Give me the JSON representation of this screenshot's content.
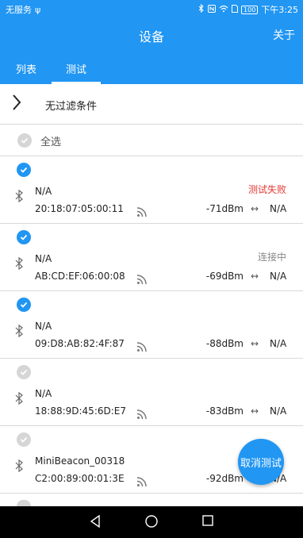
{
  "statusbar": {
    "carrier": "无服务",
    "usb_symbol": "ψ",
    "battery": "100",
    "time": "下午3:25"
  },
  "appbar": {
    "title": "设备",
    "about": "关于"
  },
  "tabs": [
    {
      "label": "列表"
    },
    {
      "label": "测试"
    }
  ],
  "filter": {
    "label": "无过滤条件"
  },
  "select_all": {
    "label": "全选"
  },
  "devices": [
    {
      "name": "N/A",
      "mac": "20:18:07:05:00:11",
      "rssi": "-71dBm",
      "arrows": "↔",
      "distance": "N/A",
      "status": "测试失败",
      "checked": true
    },
    {
      "name": "N/A",
      "mac": "AB:CD:EF:06:00:08",
      "rssi": "-69dBm",
      "arrows": "↔",
      "distance": "N/A",
      "status": "连接中",
      "checked": true
    },
    {
      "name": "N/A",
      "mac": "09:D8:AB:82:4F:87",
      "rssi": "-88dBm",
      "arrows": "↔",
      "distance": "N/A",
      "status": "",
      "checked": true
    },
    {
      "name": "N/A",
      "mac": "18:88:9D:45:6D:E7",
      "rssi": "-83dBm",
      "arrows": "↔",
      "distance": "N/A",
      "status": "",
      "checked": false
    },
    {
      "name": "MiniBeacon_00318",
      "mac": "C2:00:89:00:01:3E",
      "rssi": "-92dBm",
      "arrows": "↔",
      "distance": "N/A",
      "status": "",
      "checked": false
    }
  ],
  "fab": {
    "label": "取消测试"
  },
  "colors": {
    "primary": "#2196f3",
    "fail": "#e53935",
    "connecting": "#888888"
  }
}
